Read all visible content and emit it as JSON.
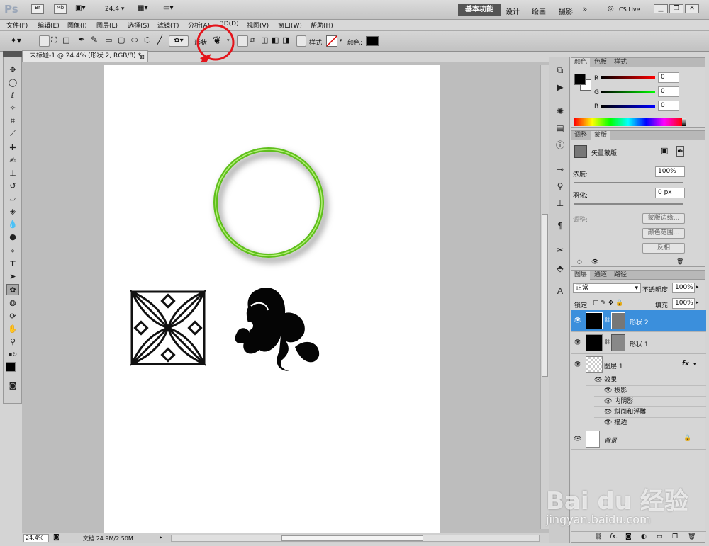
{
  "app": {
    "logo": "Ps",
    "zoom_dropdown": "24.4",
    "workspaces": [
      "基本功能",
      "设计",
      "绘画",
      "摄影",
      "»"
    ],
    "cslive": "CS Live"
  },
  "menu": [
    "文件(F)",
    "编辑(E)",
    "图像(I)",
    "图层(L)",
    "选择(S)",
    "滤镜(T)",
    "分析(A)",
    "3D(D)",
    "视图(V)",
    "窗口(W)",
    "帮助(H)"
  ],
  "options": {
    "shape_label": "形状:",
    "style_label": "样式:",
    "color_label": "颜色:",
    "color": "#000000"
  },
  "document": {
    "tab_title": "未标题-1 @ 24.4% (形状 2, RGB/8) *",
    "zoom": "24.4%",
    "doc_info": "文档:24.9M/2.50M"
  },
  "color_panel": {
    "tabs": [
      "颜色",
      "色板",
      "样式"
    ],
    "channels": [
      {
        "name": "R",
        "value": "0"
      },
      {
        "name": "G",
        "value": "0"
      },
      {
        "name": "B",
        "value": "0"
      }
    ]
  },
  "mask_panel": {
    "tabs": [
      "调整",
      "蒙版"
    ],
    "title": "矢量蒙版",
    "density_label": "浓度:",
    "density": "100%",
    "feather_label": "羽化:",
    "feather": "0 px",
    "refine_label": "调整:",
    "buttons": [
      "蒙版边缘...",
      "颜色范围...",
      "反相"
    ]
  },
  "layers_panel": {
    "tabs": [
      "图层",
      "通道",
      "路径"
    ],
    "blend_mode": "正常",
    "opacity_label": "不透明度:",
    "opacity": "100%",
    "lock_label": "锁定:",
    "fill_label": "填充:",
    "fill": "100%",
    "layers": [
      {
        "name": "形状 2",
        "selected": true
      },
      {
        "name": "形状 1",
        "selected": false
      },
      {
        "name": "图层 1",
        "selected": false
      },
      {
        "name": "背景",
        "selected": false
      }
    ],
    "effects_label": "效果",
    "effects": [
      "投影",
      "内阴影",
      "斜面和浮雕",
      "描边"
    ],
    "fx": "fx"
  },
  "watermark": {
    "brand": "Bai du 经验",
    "url": "jingyan.baidu.com"
  }
}
